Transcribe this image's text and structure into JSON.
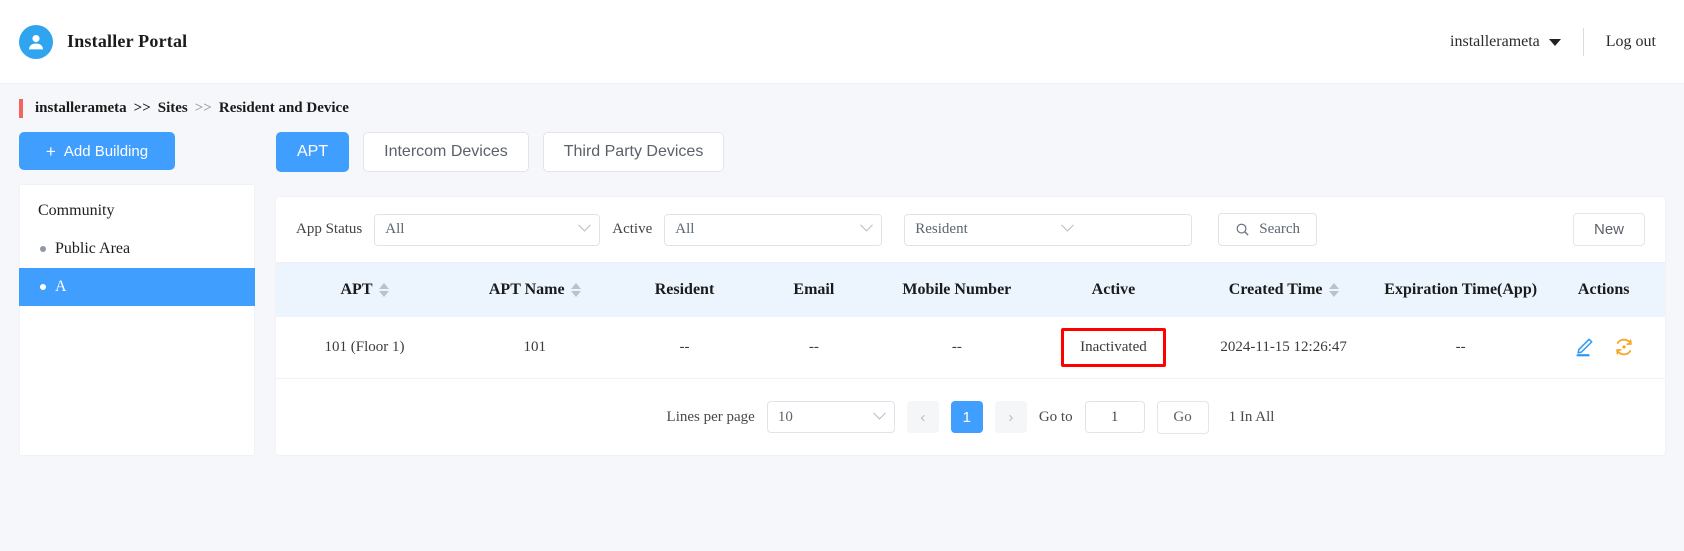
{
  "header": {
    "brand_title": "Installer Portal",
    "avatar_icon": "user-avatar-icon",
    "username": "installerameta",
    "logout_label": "Log out"
  },
  "breadcrumb": {
    "items": [
      "installerameta",
      "Sites",
      "Resident and Device"
    ],
    "separator": ">>"
  },
  "sidebar": {
    "add_building_label": "Add Building",
    "add_building_plus": "+",
    "root_label": "Community",
    "items": [
      {
        "label": "Public Area",
        "active": false
      },
      {
        "label": "A",
        "active": true
      }
    ]
  },
  "tabs": [
    {
      "label": "APT",
      "active": true
    },
    {
      "label": "Intercom Devices",
      "active": false
    },
    {
      "label": "Third Party Devices",
      "active": false
    }
  ],
  "filters": {
    "app_status_label": "App Status",
    "app_status_value": "All",
    "active_label": "Active",
    "active_value": "All",
    "field_value": "Resident",
    "keyword_value": "",
    "keyword_placeholder": "",
    "search_label": "Search",
    "search_icon": "search-icon",
    "new_label": "New"
  },
  "table": {
    "columns": [
      {
        "label": "APT",
        "sortable": true
      },
      {
        "label": "APT Name",
        "sortable": true
      },
      {
        "label": "Resident",
        "sortable": false
      },
      {
        "label": "Email",
        "sortable": false
      },
      {
        "label": "Mobile Number",
        "sortable": false
      },
      {
        "label": "Active",
        "sortable": false
      },
      {
        "label": "Created Time",
        "sortable": true
      },
      {
        "label": "Expiration Time(App)",
        "sortable": false
      },
      {
        "label": "Actions",
        "sortable": false
      }
    ],
    "rows": [
      {
        "apt": "101 (Floor 1)",
        "apt_name": "101",
        "resident": "--",
        "email": "--",
        "mobile": "--",
        "active": "Inactivated",
        "created_time": "2024-11-15 12:26:47",
        "expiration": "--",
        "edit_icon": "pencil-edit-icon",
        "reset_icon": "reset-refresh-icon"
      }
    ]
  },
  "annotation": {
    "highlight_color": "#ff0000",
    "target": "Inactivated"
  },
  "pagination": {
    "lines_label": "Lines per page",
    "lines_value": "10",
    "prev_icon": "chevron-left-icon",
    "next_icon": "chevron-right-icon",
    "current_page": "1",
    "goto_label": "Go to",
    "goto_value": "1",
    "go_label": "Go",
    "total_label": "1 In All"
  },
  "colors": {
    "accent": "#409eff",
    "avatar": "#2fa5f0",
    "crumb_accent": "#f4645f",
    "table_header": "#ecf5fd",
    "edit_icon": "#2f9bf5",
    "reset_icon": "#f5a623"
  }
}
